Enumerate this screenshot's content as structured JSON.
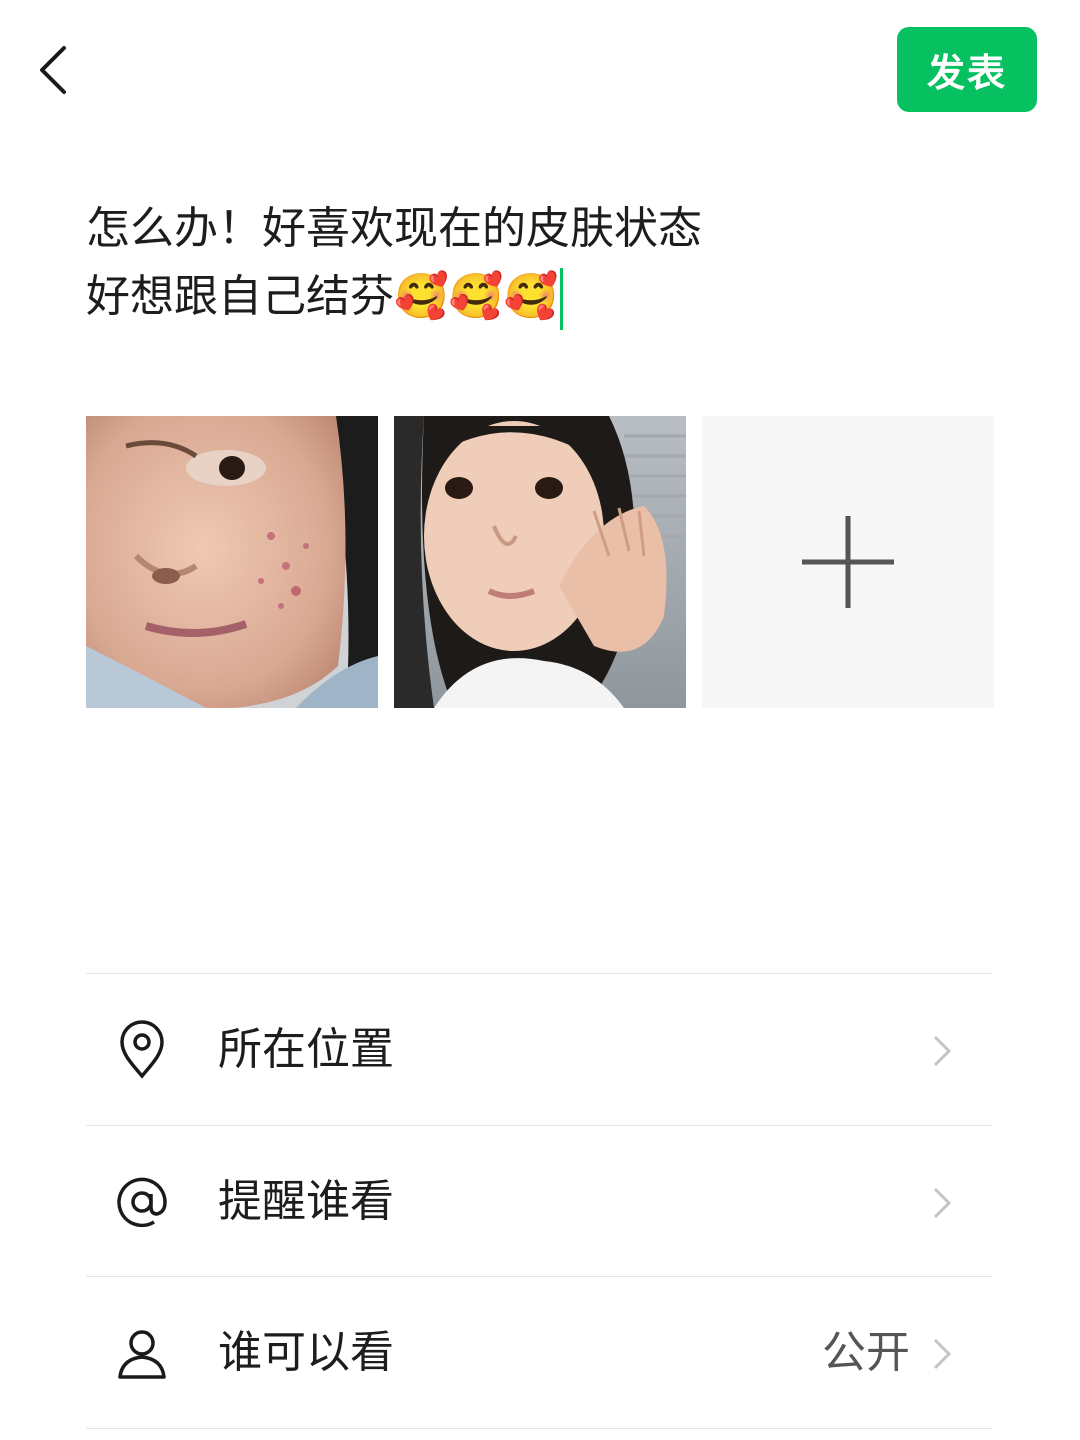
{
  "header": {
    "back_icon": "chevron-left-icon",
    "post_label": "发表",
    "accent_color": "#07c160"
  },
  "composer": {
    "line1": "怎么办！好喜欢现在的皮肤状态",
    "line2_text": "好想跟自己结芬",
    "line2_emojis": "🥰🥰🥰"
  },
  "photos": [
    {
      "name": "photo-1",
      "description": "selfie-left"
    },
    {
      "name": "photo-2",
      "description": "selfie-right"
    }
  ],
  "add_photo": {
    "icon": "plus-icon"
  },
  "options": [
    {
      "icon": "location-pin-icon",
      "label": "所在位置",
      "value": ""
    },
    {
      "icon": "at-mention-icon",
      "label": "提醒谁看",
      "value": ""
    },
    {
      "icon": "person-icon",
      "label": "谁可以看",
      "value": "公开"
    }
  ]
}
